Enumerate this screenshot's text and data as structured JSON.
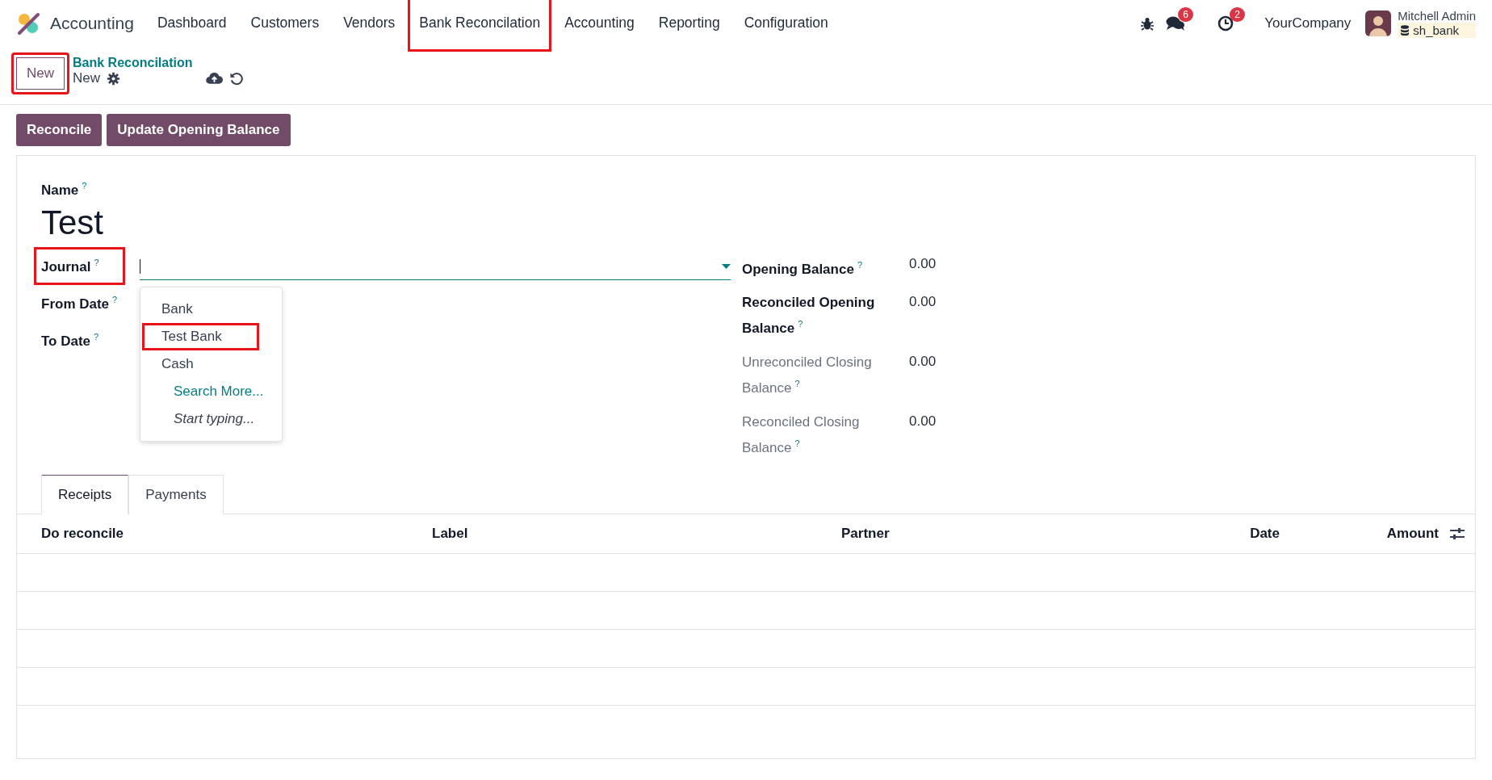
{
  "navbar": {
    "app_name": "Accounting",
    "menu": [
      {
        "label": "Dashboard",
        "highlighted": false
      },
      {
        "label": "Customers",
        "highlighted": false
      },
      {
        "label": "Vendors",
        "highlighted": false
      },
      {
        "label": "Bank Reconcilation",
        "highlighted": true
      },
      {
        "label": "Accounting",
        "highlighted": false
      },
      {
        "label": "Reporting",
        "highlighted": false
      },
      {
        "label": "Configuration",
        "highlighted": false
      }
    ],
    "messages_count": "6",
    "activities_count": "2",
    "company": "YourCompany",
    "user": {
      "name": "Mitchell Admin",
      "database": "sh_bank"
    }
  },
  "control_panel": {
    "new_button": {
      "label": "New",
      "highlighted": true
    },
    "breadcrumb": "Bank Reconcilation",
    "record": "New"
  },
  "actions": [
    "Reconcile",
    "Update Opening Balance"
  ],
  "form": {
    "name_label": "Name",
    "name_help": "?",
    "name": "Test",
    "left_fields": [
      {
        "label": "Journal",
        "help": "?",
        "kind": "dropdown",
        "highlighted": true
      },
      {
        "label": "From Date",
        "help": "?",
        "kind": "date",
        "highlighted": false
      },
      {
        "label": "To Date",
        "help": "?",
        "kind": "date",
        "highlighted": false
      }
    ],
    "journal_dropdown": {
      "options": [
        {
          "label": "Bank",
          "highlighted": false
        },
        {
          "label": "Test Bank",
          "highlighted": true
        },
        {
          "label": "Cash",
          "highlighted": false
        }
      ],
      "search_more": "Search More...",
      "hint": "Start typing..."
    },
    "right_fields": [
      {
        "label": "Opening Balance",
        "help": "?",
        "value": "0.00",
        "muted": false
      },
      {
        "label": "Reconciled Opening Balance",
        "help": "?",
        "value": "0.00",
        "muted": false
      },
      {
        "label": "Unreconciled Closing Balance",
        "help": "?",
        "value": "0.00",
        "muted": true
      },
      {
        "label": "Reconciled Closing Balance",
        "help": "?",
        "value": "0.00",
        "muted": true
      }
    ],
    "tabs": [
      {
        "label": "Receipts",
        "selected": true
      },
      {
        "label": "Payments",
        "selected": false
      }
    ],
    "table": {
      "columns": [
        "Do reconcile",
        "Label",
        "Partner",
        "Date",
        "Amount"
      ]
    }
  }
}
